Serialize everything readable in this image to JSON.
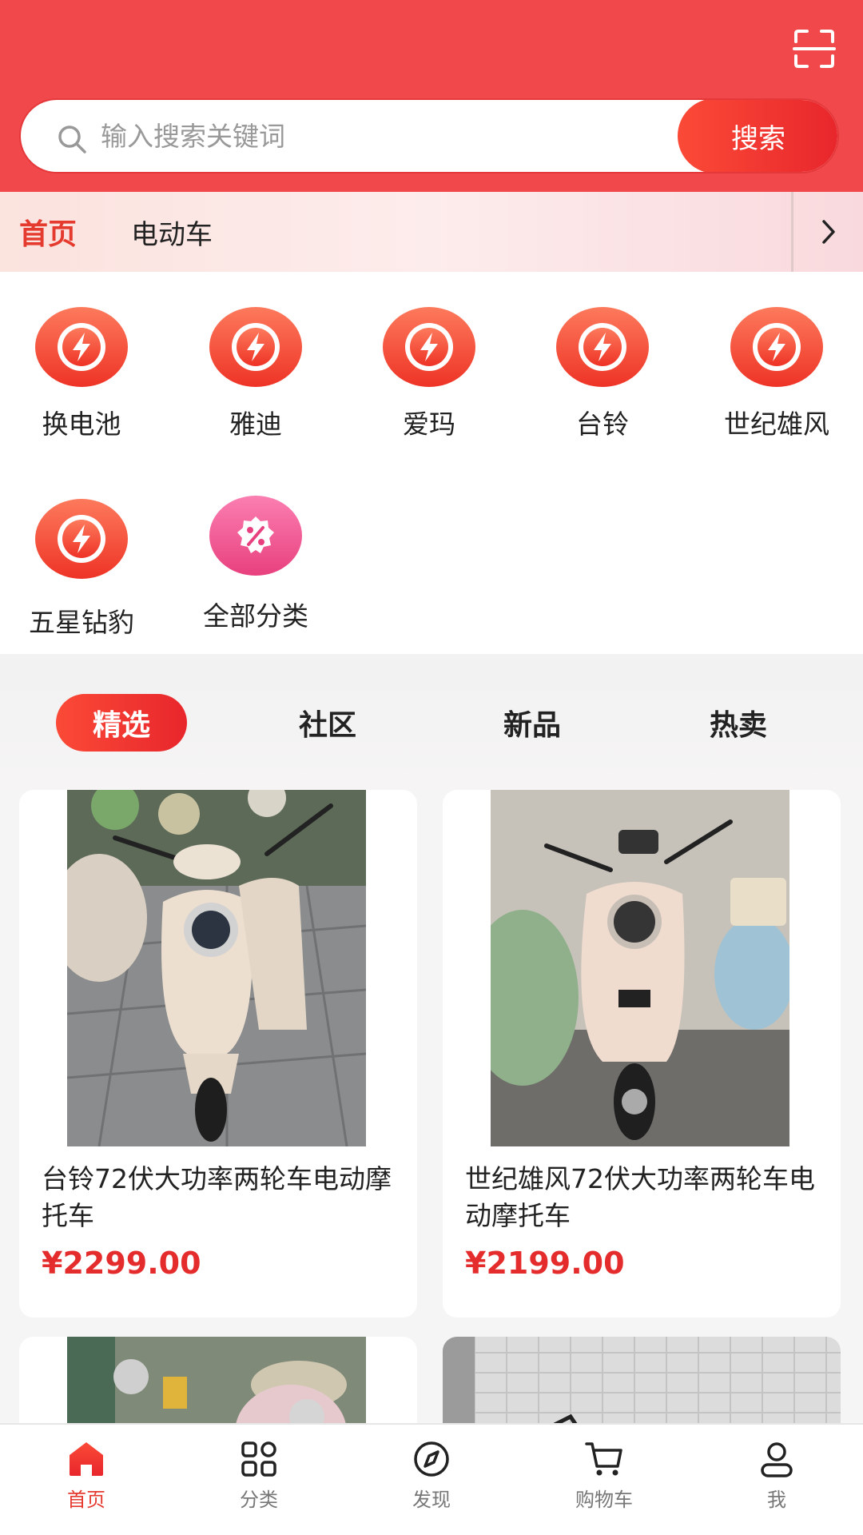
{
  "header": {
    "scan_icon": "scan-icon",
    "search_placeholder": "输入搜索关键词",
    "search_button": "搜索"
  },
  "topnav": {
    "items": [
      {
        "label": "首页",
        "active": true
      },
      {
        "label": "电动车",
        "active": false
      }
    ],
    "more_icon": "chevron-right-icon"
  },
  "categories": [
    {
      "label": "换电池",
      "icon": "lightning-clock-icon"
    },
    {
      "label": "雅迪",
      "icon": "lightning-clock-icon"
    },
    {
      "label": "爱玛",
      "icon": "lightning-clock-icon"
    },
    {
      "label": "台铃",
      "icon": "lightning-clock-icon"
    },
    {
      "label": "世纪雄风",
      "icon": "lightning-clock-icon"
    },
    {
      "label": "五星钻豹",
      "icon": "lightning-clock-icon"
    },
    {
      "label": "全部分类",
      "icon": "discount-badge-icon"
    }
  ],
  "content_tabs": [
    {
      "label": "精选",
      "active": true
    },
    {
      "label": "社区",
      "active": false
    },
    {
      "label": "新品",
      "active": false
    },
    {
      "label": "热卖",
      "active": false
    }
  ],
  "products": [
    {
      "title": "台铃72伏大功率两轮车电动摩托车",
      "price": "¥2299.00"
    },
    {
      "title": "世纪雄风72伏大功率两轮车电动摩托车",
      "price": "¥2199.00"
    }
  ],
  "tabbar": [
    {
      "label": "首页",
      "icon": "home-icon",
      "active": true
    },
    {
      "label": "分类",
      "icon": "grid-icon",
      "active": false
    },
    {
      "label": "发现",
      "icon": "compass-icon",
      "active": false
    },
    {
      "label": "购物车",
      "icon": "cart-icon",
      "active": false
    },
    {
      "label": "我",
      "icon": "user-icon",
      "active": false
    }
  ],
  "colors": {
    "brand_red": "#f1484b",
    "accent_red": "#e8262c",
    "price_red": "#e52c2c"
  }
}
